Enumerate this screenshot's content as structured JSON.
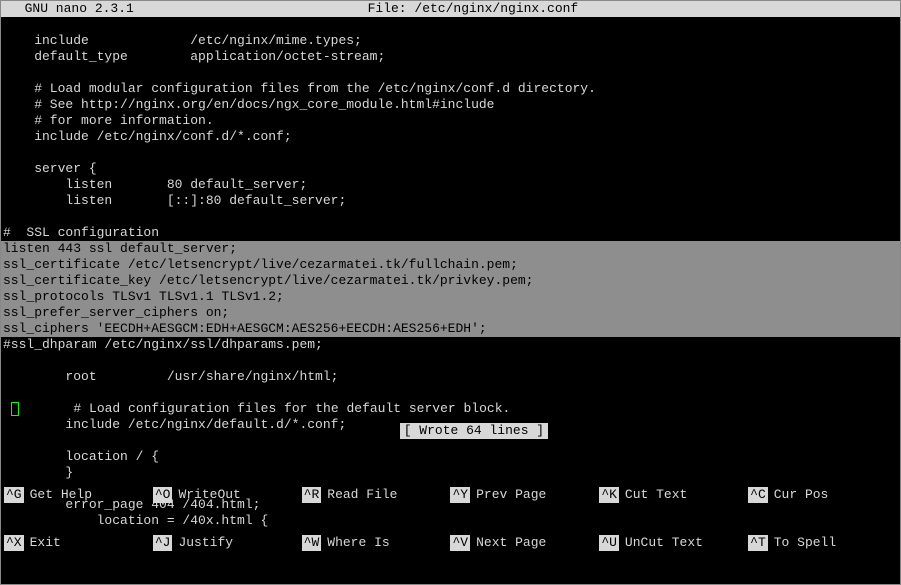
{
  "title": {
    "left": "  GNU nano 2.3.1",
    "center": "File: /etc/nginx/nginx.conf"
  },
  "status": "[ Wrote 64 lines ]",
  "lines": [
    {
      "t": "",
      "hl": false
    },
    {
      "t": "    include             /etc/nginx/mime.types;",
      "hl": false
    },
    {
      "t": "    default_type        application/octet-stream;",
      "hl": false
    },
    {
      "t": "",
      "hl": false
    },
    {
      "t": "    # Load modular configuration files from the /etc/nginx/conf.d directory.",
      "hl": false
    },
    {
      "t": "    # See http://nginx.org/en/docs/ngx_core_module.html#include",
      "hl": false
    },
    {
      "t": "    # for more information.",
      "hl": false
    },
    {
      "t": "    include /etc/nginx/conf.d/*.conf;",
      "hl": false
    },
    {
      "t": "",
      "hl": false
    },
    {
      "t": "    server {",
      "hl": false
    },
    {
      "t": "        listen       80 default_server;",
      "hl": false
    },
    {
      "t": "        listen       [::]:80 default_server;",
      "hl": false
    },
    {
      "t": "",
      "hl": false
    },
    {
      "t": "#  SSL configuration",
      "hl": false
    },
    {
      "t": "listen 443 ssl default_server;",
      "hl": true
    },
    {
      "t": "ssl_certificate /etc/letsencrypt/live/cezarmatei.tk/fullchain.pem;",
      "hl": true
    },
    {
      "t": "ssl_certificate_key /etc/letsencrypt/live/cezarmatei.tk/privkey.pem;",
      "hl": true
    },
    {
      "t": "ssl_protocols TLSv1 TLSv1.1 TLSv1.2;",
      "hl": true
    },
    {
      "t": "ssl_prefer_server_ciphers on;",
      "hl": true
    },
    {
      "t": "ssl_ciphers 'EECDH+AESGCM:EDH+AESGCM:AES256+EECDH:AES256+EDH';",
      "hl": true
    },
    {
      "t": "#ssl_dhparam /etc/nginx/ssl/dhparams.pem;",
      "hl": false,
      "cursor_before": false
    },
    {
      "t": "",
      "hl": false
    },
    {
      "t": "        root         /usr/share/nginx/html;",
      "hl": false
    },
    {
      "t": "",
      "hl": false
    },
    {
      "t": "        # Load configuration files for the default server block.",
      "hl": false,
      "cursor_row": true
    },
    {
      "t": "        include /etc/nginx/default.d/*.conf;",
      "hl": false
    },
    {
      "t": "",
      "hl": false
    },
    {
      "t": "        location / {",
      "hl": false
    },
    {
      "t": "        }",
      "hl": false
    },
    {
      "t": "",
      "hl": false
    },
    {
      "t": "        error_page 404 /404.html;",
      "hl": false
    },
    {
      "t": "            location = /40x.html {",
      "hl": false
    }
  ],
  "help": {
    "row1": [
      {
        "key": "^G",
        "label": "Get Help"
      },
      {
        "key": "^O",
        "label": "WriteOut"
      },
      {
        "key": "^R",
        "label": "Read File"
      },
      {
        "key": "^Y",
        "label": "Prev Page"
      },
      {
        "key": "^K",
        "label": "Cut Text"
      },
      {
        "key": "^C",
        "label": "Cur Pos"
      }
    ],
    "row2": [
      {
        "key": "^X",
        "label": "Exit"
      },
      {
        "key": "^J",
        "label": "Justify"
      },
      {
        "key": "^W",
        "label": "Where Is"
      },
      {
        "key": "^V",
        "label": "Next Page"
      },
      {
        "key": "^U",
        "label": "UnCut Text"
      },
      {
        "key": "^T",
        "label": "To Spell"
      }
    ]
  }
}
